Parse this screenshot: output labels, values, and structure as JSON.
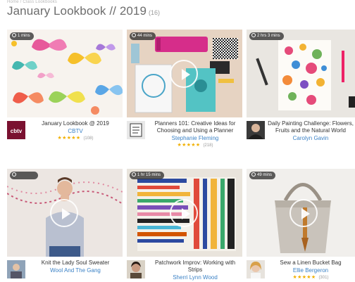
{
  "breadcrumb": "Home / Class Lookbooks",
  "page": {
    "title": "January Lookbook // 2019",
    "count": "(16)"
  },
  "cards": [
    {
      "duration": "1 mins",
      "title": "January Lookbook @ 2019",
      "author": "CBTV",
      "stars": "★★★★★",
      "reviews": "(108)",
      "avatar_text": "cbtv"
    },
    {
      "duration": "44 mins",
      "title": "Planners 101: Creative Ideas for Choosing and Using a Planner",
      "author": "Stephanie Fleming",
      "stars": "★★★★★",
      "reviews": "(218)"
    },
    {
      "duration": "2 hrs 3 mins",
      "title": "Daily Painting Challenge: Flowers, Fruits and the Natural World",
      "author": "Carolyn Gavin",
      "stars": "",
      "reviews": ""
    },
    {
      "duration": "",
      "title": "Knit the Lady Soul Sweater",
      "author": "Wool And The Gang",
      "stars": "",
      "reviews": ""
    },
    {
      "duration": "1 hr 15 mins",
      "title": "Patchwork Improv: Working with Strips",
      "author": "Sherri Lynn Wood",
      "stars": "",
      "reviews": ""
    },
    {
      "duration": "49 mins",
      "title": "Sew a Linen Bucket Bag",
      "author": "Ellie Bergeron",
      "stars": "★★★★★",
      "reviews": "(301)"
    }
  ]
}
